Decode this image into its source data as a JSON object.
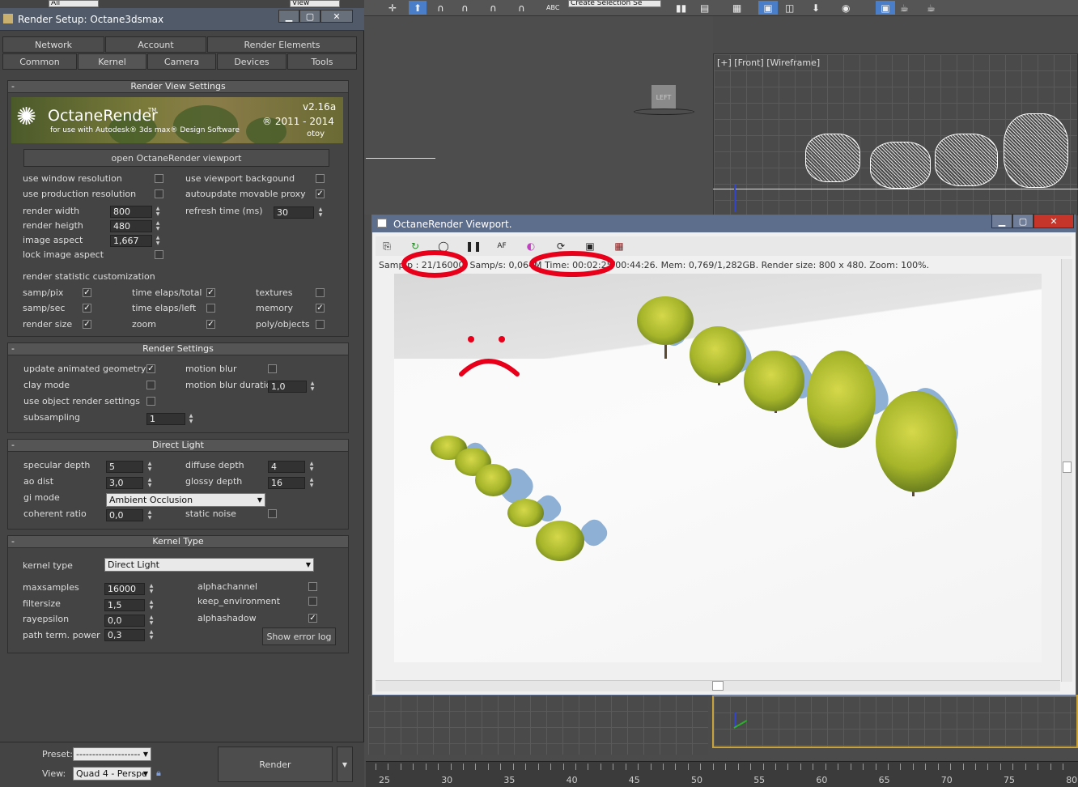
{
  "top_toolbar": {
    "select_all": "All",
    "select_view": "View",
    "create_selection": "Create Selection Se"
  },
  "front_viewport": {
    "label": "[+] [Front] [Wireframe]"
  },
  "view_cube": {
    "label": "LEFT"
  },
  "timeline": {
    "ticks": [
      "25",
      "30",
      "35",
      "40",
      "45",
      "50",
      "55",
      "60",
      "65",
      "70",
      "75",
      "80"
    ]
  },
  "render_setup": {
    "title": "Render Setup: Octane3dsmax",
    "tabs_row1": [
      "Network",
      "Account",
      "Render Elements"
    ],
    "tabs_row2": [
      "Common",
      "Kernel",
      "Camera",
      "Devices",
      "Tools"
    ],
    "active_tab": "Kernel",
    "render_view": {
      "header": "Render View Settings",
      "banner": {
        "product": "OctaneRender",
        "tm": "TM",
        "tagline": "for use with Autodesk® 3ds max® Design Software",
        "version": "v2.16a",
        "copyright": "® 2011 - 2014",
        "company": "otoy"
      },
      "open_viewport_button": "open OctaneRender viewport",
      "left_checks": [
        {
          "label": "use window resolution",
          "checked": false
        },
        {
          "label": "use production resolution",
          "checked": false
        }
      ],
      "right_checks": [
        {
          "label": "use viewport backgound",
          "checked": false
        },
        {
          "label": "autoupdate movable proxy",
          "checked": true
        }
      ],
      "render_width_label": "render width",
      "render_width": "800",
      "render_height_label": "render heigth",
      "render_height": "480",
      "image_aspect_label": "image aspect",
      "image_aspect": "1,667",
      "lock_aspect_label": "lock image aspect",
      "refresh_label": "refresh time (ms)",
      "refresh": "30",
      "stat_header": "render statistic customization",
      "stats": [
        {
          "label": "samp/pix",
          "checked": true
        },
        {
          "label": "samp/sec",
          "checked": true
        },
        {
          "label": "render size",
          "checked": true
        },
        {
          "label": "time elaps/total",
          "checked": true
        },
        {
          "label": "time elaps/left",
          "checked": false
        },
        {
          "label": "zoom",
          "checked": true
        },
        {
          "label": "textures",
          "checked": false
        },
        {
          "label": "memory",
          "checked": true
        },
        {
          "label": "poly/objects",
          "checked": false
        }
      ]
    },
    "render_settings": {
      "header": "Render Settings",
      "update_geo": "update animated geometry",
      "clay_mode": "clay mode",
      "object_settings": "use object render settings",
      "subsampling_label": "subsampling",
      "subsampling": "1",
      "motion_blur": "motion blur",
      "motion_blur_duration_label": "motion blur duration",
      "motion_blur_duration": "1,0"
    },
    "direct_light": {
      "header": "Direct Light",
      "specular_label": "specular depth",
      "specular": "5",
      "ao_label": "ao dist",
      "ao": "3,0",
      "gi_label": "gi mode",
      "gi": "Ambient Occlusion",
      "coherent_label": "coherent ratio",
      "coherent": "0,0",
      "diffuse_label": "diffuse depth",
      "diffuse": "4",
      "glossy_label": "glossy depth",
      "glossy": "16",
      "static_noise": "static noise"
    },
    "kernel_type": {
      "header": "Kernel Type",
      "kernel_label": "kernel type",
      "kernel": "Direct Light",
      "maxsamples_label": "maxsamples",
      "maxsamples": "16000",
      "filtersize_label": "filtersize",
      "filtersize": "1,5",
      "rayepsilon_label": "rayepsilon",
      "rayepsilon": "0,0",
      "pathterm_label": "path term. power",
      "pathterm": "0,3",
      "alphachannel": "alphachannel",
      "keep_env": "keep_environment",
      "alphashadow": "alphashadow",
      "error_log": "Show error log"
    },
    "footer": {
      "preset_label": "Preset:",
      "preset": "--------------------",
      "view_label": "View:",
      "view": "Quad 4 - Perspe",
      "render_button": "Render"
    }
  },
  "octane_viewport": {
    "title": "OctaneRender Viewport.",
    "status": "Samp/p : 21/16000.  Samp/s: 0,064M  Time: 00:02:25/00:44:26.  Mem: 0,769/1,282GB.  Render size: 800 x 480.  Zoom: 100%."
  },
  "colors": {
    "accent": "#5d6d8c",
    "annotation": "#e8001a",
    "viewport_active": "#c9a23a"
  }
}
